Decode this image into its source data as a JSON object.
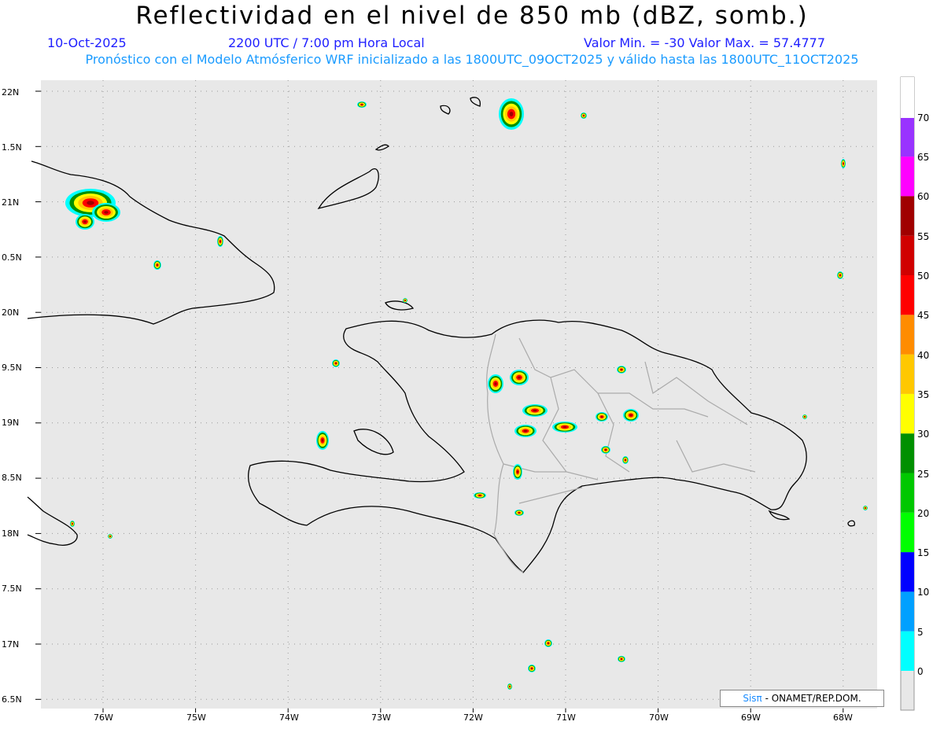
{
  "header": {
    "title": "Reflectividad en el nivel de 850 mb (dBZ, somb.)",
    "date": "10-Oct-2025",
    "time": "2200 UTC / 7:00 pm Hora Local",
    "valrange": "Valor Min. = -30  Valor Max. = 57.4777",
    "forecast": "Pronóstico con el Modelo Atmósferico WRF inicializado a las 1800UTC_09OCT2025 y válido hasta las  1800UTC_11OCT2025"
  },
  "lat_labels": [
    "22N",
    "1.5N",
    "21N",
    "0.5N",
    "20N",
    "9.5N",
    "19N",
    "8.5N",
    "18N",
    "7.5N",
    "17N",
    "6.5N"
  ],
  "lon_labels": [
    "76W",
    "75W",
    "74W",
    "73W",
    "72W",
    "71W",
    "70W",
    "69W",
    "68W"
  ],
  "colorbar": {
    "colors": [
      "#00ffff",
      "#00a0ff",
      "#0000ff",
      "#00ff00",
      "#00c800",
      "#009000",
      "#ffff00",
      "#ffc800",
      "#ff8c00",
      "#ff0000",
      "#d00000",
      "#a00000",
      "#ff00ff",
      "#9933ff",
      "#ffffff"
    ],
    "labels": [
      "0",
      "5",
      "10",
      "15",
      "20",
      "25",
      "30",
      "35",
      "40",
      "45",
      "50",
      "55",
      "60",
      "65",
      "70"
    ]
  },
  "credit": {
    "sis": "Sisπ",
    "text": " - ONAMET/REP.DOM."
  }
}
